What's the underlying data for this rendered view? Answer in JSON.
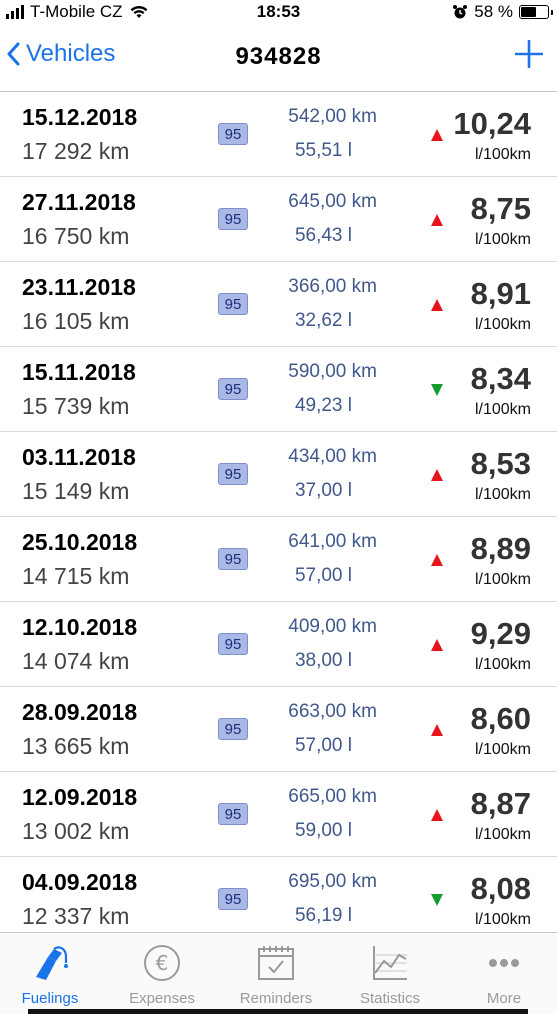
{
  "status_bar": {
    "carrier": "T-Mobile CZ",
    "time": "18:53",
    "battery": "58 %",
    "battery_level": 0.58
  },
  "nav": {
    "back_label": "Vehicles",
    "title": "934828",
    "add_icon": "plus-icon"
  },
  "entries": [
    {
      "date": "15.12.2018",
      "odometer": "17 292 km",
      "fuel": "95",
      "distance": "542,00 km",
      "volume": "55,51 l",
      "trend": "up",
      "consumption": "10,24",
      "unit": "l/100km"
    },
    {
      "date": "27.11.2018",
      "odometer": "16 750 km",
      "fuel": "95",
      "distance": "645,00 km",
      "volume": "56,43 l",
      "trend": "up",
      "consumption": "8,75",
      "unit": "l/100km"
    },
    {
      "date": "23.11.2018",
      "odometer": "16 105 km",
      "fuel": "95",
      "distance": "366,00 km",
      "volume": "32,62 l",
      "trend": "up",
      "consumption": "8,91",
      "unit": "l/100km"
    },
    {
      "date": "15.11.2018",
      "odometer": "15 739 km",
      "fuel": "95",
      "distance": "590,00 km",
      "volume": "49,23 l",
      "trend": "down",
      "consumption": "8,34",
      "unit": "l/100km"
    },
    {
      "date": "03.11.2018",
      "odometer": "15 149 km",
      "fuel": "95",
      "distance": "434,00 km",
      "volume": "37,00 l",
      "trend": "up",
      "consumption": "8,53",
      "unit": "l/100km"
    },
    {
      "date": "25.10.2018",
      "odometer": "14 715 km",
      "fuel": "95",
      "distance": "641,00 km",
      "volume": "57,00 l",
      "trend": "up",
      "consumption": "8,89",
      "unit": "l/100km"
    },
    {
      "date": "12.10.2018",
      "odometer": "14 074 km",
      "fuel": "95",
      "distance": "409,00 km",
      "volume": "38,00 l",
      "trend": "up",
      "consumption": "9,29",
      "unit": "l/100km"
    },
    {
      "date": "28.09.2018",
      "odometer": "13 665 km",
      "fuel": "95",
      "distance": "663,00 km",
      "volume": "57,00 l",
      "trend": "up",
      "consumption": "8,60",
      "unit": "l/100km"
    },
    {
      "date": "12.09.2018",
      "odometer": "13 002 km",
      "fuel": "95",
      "distance": "665,00 km",
      "volume": "59,00 l",
      "trend": "up",
      "consumption": "8,87",
      "unit": "l/100km"
    },
    {
      "date": "04.09.2018",
      "odometer": "12 337 km",
      "fuel": "95",
      "distance": "695,00 km",
      "volume": "56,19 l",
      "trend": "down",
      "consumption": "8,08",
      "unit": "l/100km"
    }
  ],
  "colors": {
    "accent": "#1a73e8",
    "trend_up": "#e8141c",
    "trend_down": "#169b2e",
    "fuel_badge": "#aab8e6"
  },
  "tabs": [
    {
      "label": "Fuelings",
      "icon": "fuel-pump-icon",
      "active": true
    },
    {
      "label": "Expenses",
      "icon": "euro-icon",
      "active": false
    },
    {
      "label": "Reminders",
      "icon": "calendar-check-icon",
      "active": false
    },
    {
      "label": "Statistics",
      "icon": "chart-icon",
      "active": false
    },
    {
      "label": "More",
      "icon": "more-dots-icon",
      "active": false
    }
  ]
}
